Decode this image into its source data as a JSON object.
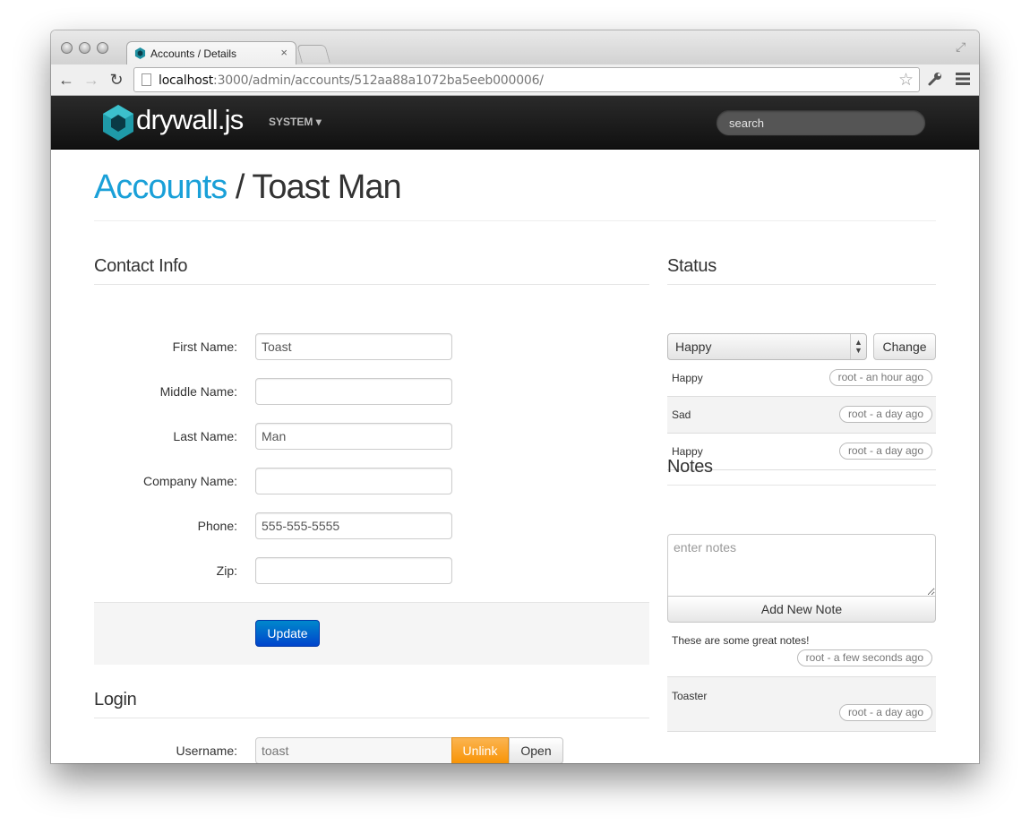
{
  "browser": {
    "tab_title": "Accounts / Details",
    "tab_close": "×",
    "url_host": "localhost",
    "url_rest": ":3000/admin/accounts/512aa88a1072ba5eeb000006/"
  },
  "navbar": {
    "brand": "drywall.js",
    "system_menu": "SYSTEM",
    "caret": "▾",
    "search_placeholder": "search"
  },
  "header": {
    "breadcrumb_link": "Accounts",
    "separator": " / ",
    "title": "Toast Man"
  },
  "contact": {
    "heading": "Contact Info",
    "fields": [
      {
        "label": "First Name:",
        "value": "Toast"
      },
      {
        "label": "Middle Name:",
        "value": ""
      },
      {
        "label": "Last Name:",
        "value": "Man"
      },
      {
        "label": "Company Name:",
        "value": ""
      },
      {
        "label": "Phone:",
        "value": "555-555-5555"
      },
      {
        "label": "Zip:",
        "value": ""
      }
    ],
    "update_label": "Update"
  },
  "login": {
    "heading": "Login",
    "username_label": "Username:",
    "username_value": "toast",
    "unlink_label": "Unlink",
    "open_label": "Open"
  },
  "status": {
    "heading": "Status",
    "selected": "Happy",
    "change_label": "Change",
    "history": [
      {
        "status": "Happy",
        "meta": "root - an hour ago"
      },
      {
        "status": "Sad",
        "meta": "root - a day ago"
      },
      {
        "status": "Happy",
        "meta": "root - a day ago"
      }
    ]
  },
  "notes": {
    "heading": "Notes",
    "placeholder": "enter notes",
    "add_label": "Add New Note",
    "items": [
      {
        "text": "These are some great notes!",
        "meta": "root - a few seconds ago"
      },
      {
        "text": "Toaster",
        "meta": "root - a day ago"
      }
    ]
  },
  "colors": {
    "link": "#1aa0d8",
    "primary": "#0055cc",
    "warning": "#f89406",
    "navbar": "#1a1a1a"
  }
}
